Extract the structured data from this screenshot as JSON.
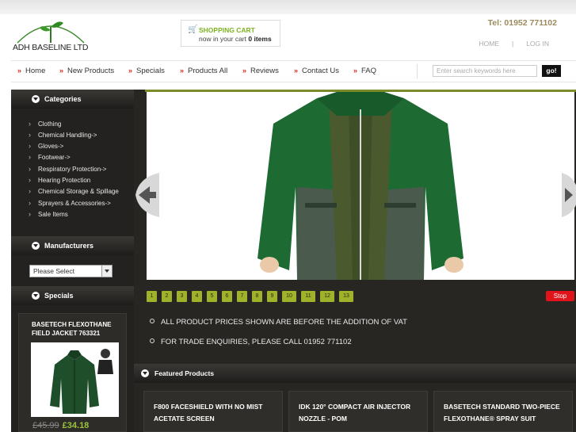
{
  "header": {
    "logo_text": "ADH BASELINE LTD",
    "cart_title": "SHOPPING CART",
    "cart_prefix": "now in your cart",
    "cart_count": "0 items",
    "phone": "Tel: 01952 771102",
    "links": {
      "home": "HOME",
      "sep": "|",
      "login": "LOG IN"
    }
  },
  "nav": {
    "items": [
      "Home",
      "New Products",
      "Specials",
      "Products All",
      "Reviews",
      "Contact Us",
      "FAQ"
    ],
    "search_placeholder": "Enter search keywords here",
    "go_label": "go!"
  },
  "sidebar": {
    "categories_title": "Categories",
    "categories": [
      "Clothing",
      "Chemical Handling->",
      "Gloves->",
      "Footwear->",
      "Respiratory Protection->",
      "Hearing Protection",
      "Chemical Storage & Spillage",
      "Sprayers & Accessories->",
      "Sale Items"
    ],
    "manufacturers_title": "Manufacturers",
    "manufacturers_selected": "Please Select",
    "specials_title": "Specials",
    "special": {
      "name": "BASETECH FLEXOTHANE FIELD JACKET 763321",
      "old_price": "£45.99",
      "new_price": "£34.18"
    }
  },
  "slider": {
    "pages": [
      "1",
      "2",
      "3",
      "4",
      "5",
      "6",
      "7",
      "8",
      "9",
      "10",
      "11",
      "12",
      "13"
    ],
    "stop_label": "Stop"
  },
  "notices": [
    "ALL PRODUCT PRICES SHOWN ARE BEFORE THE ADDITION OF VAT",
    "FOR TRADE ENQUIRIES, PLEASE CALL 01952 771102"
  ],
  "featured": {
    "title": "Featured Products",
    "products": [
      "F800 FACESHIELD WITH NO MIST ACETATE SCREEN",
      "IDK 120° COMPACT AIR INJECTOR NOZZLE - POM",
      "BASETECH STANDARD TWO-PIECE FLEXOTHANE® SPRAY SUIT"
    ]
  },
  "colors": {
    "accent_green": "#9fb22a",
    "nav_arrow": "#d9291c",
    "phone": "#9b8a5c",
    "dark_bg": "#272623",
    "stop_red": "#e0141a"
  }
}
